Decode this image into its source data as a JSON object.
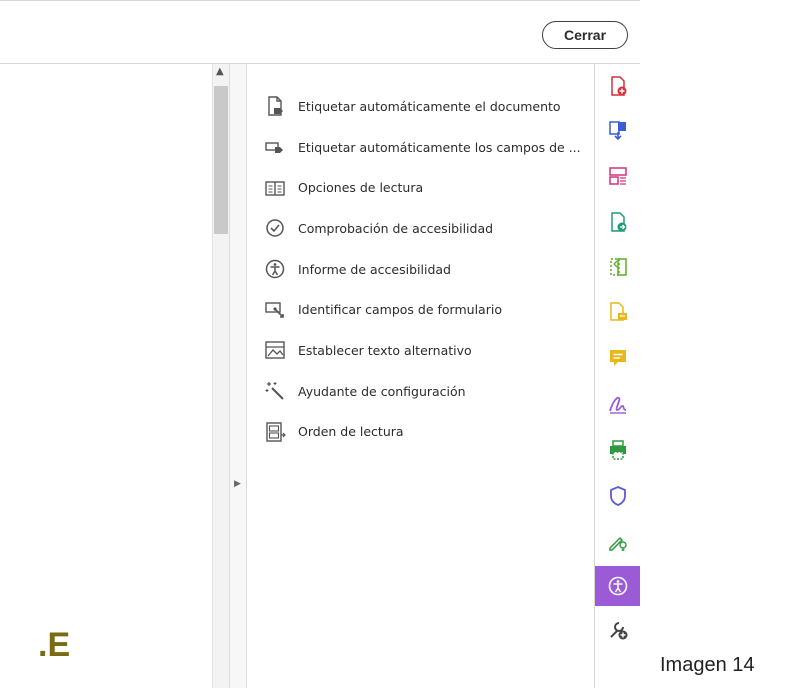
{
  "toolbar": {
    "close_label": "Cerrar"
  },
  "document": {
    "fragment_text": ".E"
  },
  "tool_panel": {
    "items": [
      {
        "label": "Etiquetar automáticamente el documento",
        "icon": "auto-tag-document-icon"
      },
      {
        "label": "Etiquetar automáticamente los campos de ...",
        "icon": "auto-tag-fields-icon"
      },
      {
        "label": "Opciones de lectura",
        "icon": "reading-options-icon"
      },
      {
        "label": "Comprobación de accesibilidad",
        "icon": "checkmark-circle-icon"
      },
      {
        "label": "Informe de accesibilidad",
        "icon": "accessibility-report-icon"
      },
      {
        "label": "Identificar campos de formulario",
        "icon": "identify-form-fields-icon"
      },
      {
        "label": "Establecer texto alternativo",
        "icon": "alt-text-icon"
      },
      {
        "label": "Ayudante de configuración",
        "icon": "magic-wand-icon"
      },
      {
        "label": "Orden de lectura",
        "icon": "reading-order-icon"
      }
    ]
  },
  "right_rail": {
    "active_index": 12,
    "accent_active": "#9b5ad6",
    "items": [
      {
        "icon": "create-pdf-icon",
        "color": "#d6303b"
      },
      {
        "icon": "combine-files-icon",
        "color": "#3b5bd9"
      },
      {
        "icon": "organize-pages-icon",
        "color": "#d6307a"
      },
      {
        "icon": "export-pdf-icon",
        "color": "#1f9a7c"
      },
      {
        "icon": "edit-pdf-icon",
        "color": "#5cad2b"
      },
      {
        "icon": "comment-file-icon",
        "color": "#e8b71c"
      },
      {
        "icon": "comment-icon",
        "color": "#e8b71c"
      },
      {
        "icon": "fill-sign-icon",
        "color": "#9b5ad6"
      },
      {
        "icon": "print-production-icon",
        "color": "#2f9a3e"
      },
      {
        "icon": "protect-shield-icon",
        "color": "#5b5bd6"
      },
      {
        "icon": "request-signature-icon",
        "color": "#2f9a3e"
      },
      {
        "icon": "accessibility-icon",
        "color": "#ffffff"
      },
      {
        "icon": "more-tools-icon",
        "color": "#444444"
      }
    ]
  },
  "caption": "Imagen 14"
}
